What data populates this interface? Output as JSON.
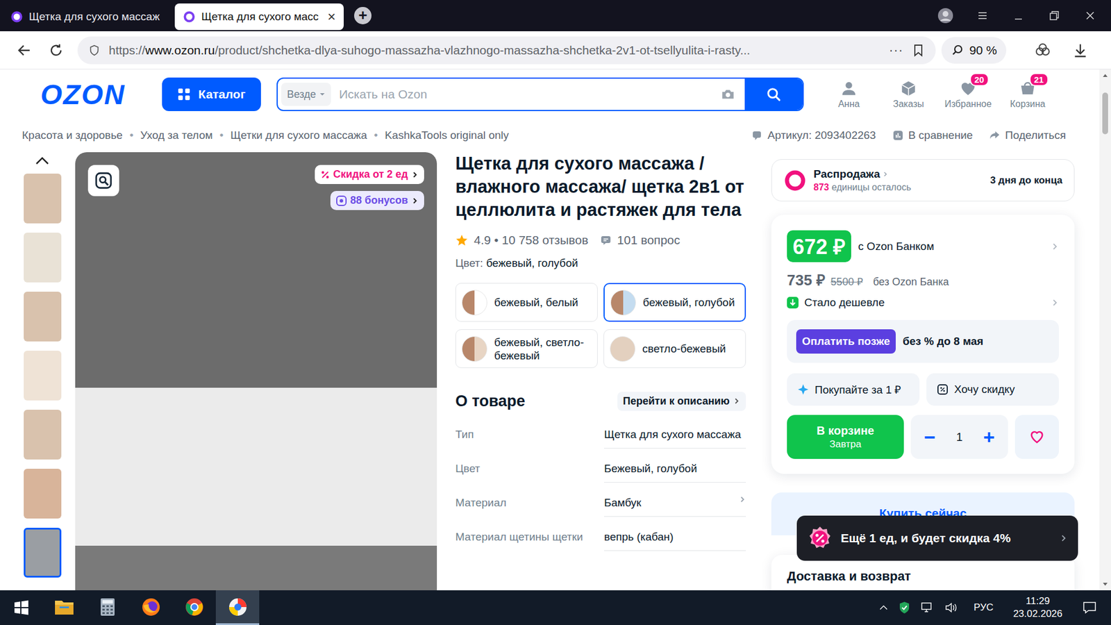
{
  "browser": {
    "tabs": [
      {
        "label": "Щетка для сухого массаж",
        "selected": false
      },
      {
        "label": "Щетка для сухого масс",
        "selected": true
      }
    ],
    "tab_close": "×",
    "new_tab": "+",
    "url": {
      "scheme": "https://",
      "domain": "www.ozon.ru",
      "path": "/product/shchetka-dlya-suhogo-massazha-vlazhnogo-massazha-shchetka-2v1-ot-tsellyulita-i-rasty..."
    },
    "more": "···",
    "zoom": "90 %"
  },
  "header": {
    "logo": "OZON",
    "catalog": "Каталог",
    "scope": "Везде",
    "placeholder": "Искать на Ozon",
    "nav": [
      {
        "label": "Анна",
        "badge": null,
        "kind": "user"
      },
      {
        "label": "Заказы",
        "badge": null,
        "kind": "orders"
      },
      {
        "label": "Избранное",
        "badge": "20",
        "kind": "favorites"
      },
      {
        "label": "Корзина",
        "badge": "21",
        "kind": "cart"
      }
    ]
  },
  "breadcrumbs": [
    "Красота и здоровье",
    "Уход за телом",
    "Щетки для сухого массажа",
    "KashkaTools original only"
  ],
  "breadcrumb_separator": "•",
  "meta": [
    {
      "label": "Артикул: 2093402263",
      "kind": "article"
    },
    {
      "label": "В сравнение",
      "kind": "compare"
    },
    {
      "label": "Поделиться",
      "kind": "share"
    }
  ],
  "gallery": {
    "thumbnails": [
      {
        "selected": false
      },
      {
        "selected": false
      },
      {
        "selected": false
      },
      {
        "selected": false
      },
      {
        "selected": false
      },
      {
        "selected": false
      },
      {
        "selected": true
      }
    ],
    "badges": [
      {
        "label": "Скидка от 2 ед",
        "kind": "discount"
      },
      {
        "label": "88 бонусов",
        "kind": "bonus"
      }
    ]
  },
  "product": {
    "title": "Щетка для сухого массажа / влажного массажа/ щетка 2в1 от целлюлита и растяжек для тела",
    "rating": "4.9",
    "separator": "•",
    "reviews": "10 758 отзывов",
    "questions": "101 вопрос",
    "color_label": "Цвет:",
    "color_value": "бежевый, голубой",
    "variants": [
      {
        "label": "бежевый, белый",
        "selected": false,
        "color": "#b8876a",
        "color2": "#ffffff"
      },
      {
        "label": "бежевый, голубой",
        "selected": true,
        "color": "#b8876a",
        "color2": "#c4dcf0"
      },
      {
        "label": "бежевый, светло-бежевый",
        "selected": false,
        "color": "#b8876a",
        "color2": "#e8d5c4"
      },
      {
        "label": "светло-бежевый",
        "selected": false,
        "color": "#e3d0bf",
        "color2": "#e3d0bf"
      }
    ]
  },
  "about": {
    "title": "О товаре",
    "link": "Перейти к описанию",
    "specs": [
      {
        "label": "Тип",
        "value": "Щетка для сухого массажа",
        "link": false
      },
      {
        "label": "Цвет",
        "value": "Бежевый, голубой",
        "link": false
      },
      {
        "label": "Материал",
        "value": "Бамбук",
        "link": true
      },
      {
        "label": "Материал щетины щетки",
        "value": "вепрь (кабан)",
        "link": false
      }
    ]
  },
  "offer": {
    "sale": {
      "title": "Распродажа",
      "count": "873",
      "count_label": "единицы осталось",
      "ends": "3 дня до конца"
    },
    "price": {
      "card": "672 ₽",
      "card_label": "с Ozon Банком",
      "regular": "735 ₽",
      "old": "5500 ₽",
      "regular_label": "без Ozon Банка",
      "note": "Стало дешевле"
    },
    "installment": {
      "button": "Оплатить позже",
      "label": "без % до 8 мая"
    },
    "actions": [
      {
        "label": "Покупайте за 1 ₽",
        "kind": "sparkle"
      },
      {
        "label": "Хочу скидку",
        "kind": "discount"
      }
    ],
    "cart": {
      "label": "В корзине",
      "sub": "Завтра",
      "quantity": "1",
      "minus": "−",
      "plus": "+"
    },
    "buy_now": "Купить сейчас",
    "delivery": "Доставка и возврат"
  },
  "toast": "Ещё 1 ед, и будет скидка 4%",
  "taskbar": {
    "apps": [
      {
        "kind": "explorer",
        "active": false
      },
      {
        "kind": "calculator",
        "active": false
      },
      {
        "kind": "firefox",
        "active": false
      },
      {
        "kind": "chrome",
        "active": false
      },
      {
        "kind": "yandex",
        "active": true
      }
    ],
    "language": "РУС",
    "time": "11:29",
    "date": "23.02.2026"
  }
}
